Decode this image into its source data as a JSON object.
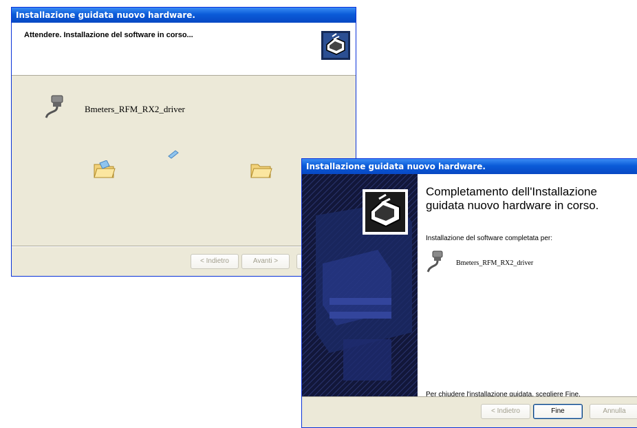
{
  "window1": {
    "title": "Installazione guidata nuovo hardware.",
    "header_text": "Attendere. Installazione del software in corso...",
    "driver_name": "Bmeters_RFM_RX2_driver",
    "buttons": {
      "back": "< Indietro",
      "next": "Avanti >"
    }
  },
  "window2": {
    "title": "Installazione guidata nuovo hardware.",
    "heading": "Completamento dell'Installazione guidata nuovo hardware in corso.",
    "subtext": "Installazione del software completata per:",
    "driver_name": "Bmeters_RFM_RX2_driver",
    "close_instruction": "Per chiudere l'installazione guidata, scegliere Fine.",
    "buttons": {
      "back": "< Indietro",
      "finish": "Fine",
      "cancel": "Annulla"
    }
  },
  "icons": [
    "hardware-wizard-icon",
    "serial-plug-icon",
    "folder-icon",
    "flying-document-icon"
  ],
  "colors": {
    "titlebar": "#0a5bd8",
    "dialog": "#ece9d8",
    "sidebar": "#12173a"
  }
}
